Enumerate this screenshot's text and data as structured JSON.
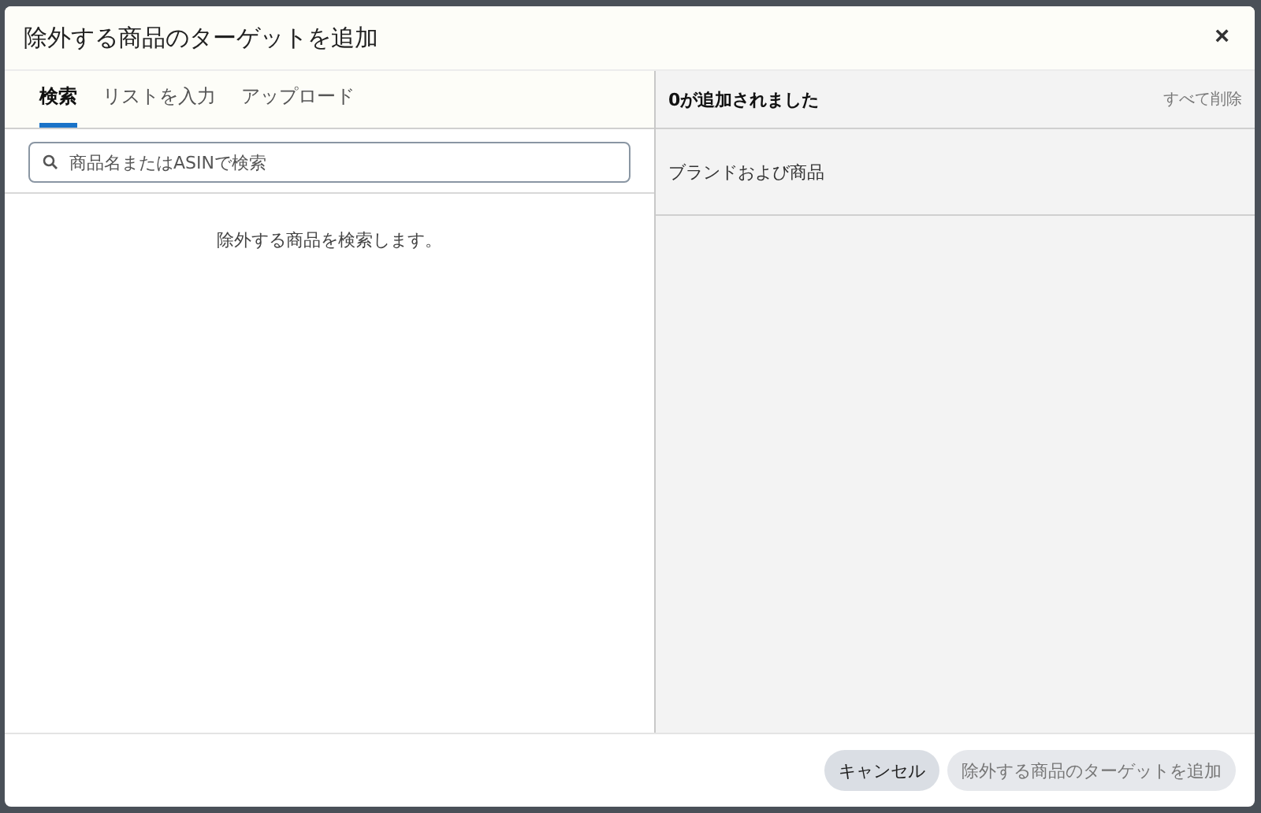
{
  "dialog": {
    "title": "除外する商品のターゲットを追加",
    "close": "×"
  },
  "tabs": [
    {
      "label": "検索",
      "selected": true
    },
    {
      "label": "リストを入力",
      "selected": false
    },
    {
      "label": "アップロード",
      "selected": false
    }
  ],
  "search": {
    "placeholder": "商品名またはASINで検索"
  },
  "empty_message": "除外する商品を検索します。",
  "added": {
    "summary": "0が追加されました",
    "remove_all": "すべて削除",
    "column": "ブランドおよび商品"
  },
  "buttons": [
    {
      "label": "キャンセル",
      "disabled": false
    },
    {
      "label": "除外する商品のターゲットを追加",
      "disabled": true
    }
  ]
}
